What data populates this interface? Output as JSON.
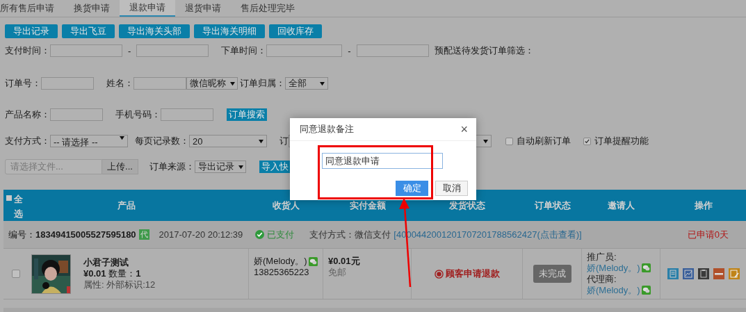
{
  "tabs": [
    {
      "label": "所有售后申请",
      "selected": false
    },
    {
      "label": "换货申请",
      "selected": false
    },
    {
      "label": "退款申请",
      "selected": true
    },
    {
      "label": "退货申请",
      "selected": false
    },
    {
      "label": "售后处理完毕",
      "selected": false
    }
  ],
  "toolbar_buttons": [
    "导出记录",
    "导出飞豆",
    "导出海关头部",
    "导出海关明细",
    "回收库存"
  ],
  "filters": {
    "pay_time_label": "支付时间：",
    "order_time_label": "下单时间：",
    "range_dash": "-",
    "presale_label": "预配送待发货订单筛选：",
    "order_no_label": "订单号：",
    "name_label": "姓名：",
    "name_type": "微信昵称",
    "ownership_label": "订单归属：",
    "ownership": "全部",
    "product_label": "产品名称：",
    "phone_label": "手机号码：",
    "search_button": "订单搜索",
    "pay_method_label": "支付方式：",
    "pay_method": "-- 请选择 --",
    "per_page_label": "每页记录数：",
    "per_page": "20",
    "cut_label": "订",
    "checkboxes": [
      {
        "label": "自动刷新订单",
        "checked": false
      },
      {
        "label": "订单提醒功能",
        "checked": true
      }
    ],
    "file_placeholder": "请选择文件...",
    "upload_button": "上传...",
    "source_label": "订单来源：",
    "source": "导出记录",
    "import_button": "导入快"
  },
  "table": {
    "select_all_label": "全选",
    "select_all_checked": false,
    "columns": [
      "产品",
      "收货人",
      "实付金额",
      "发货状态",
      "订单状态",
      "邀请人",
      "操作"
    ]
  },
  "orders": [
    {
      "number_label": "编号：",
      "number": "18349415005527595180",
      "agent_badge": "代",
      "time": "2017-07-20 20:12:39",
      "paid_status": "已支付",
      "pay_method": "支付方式：微信支付",
      "transaction": "[4000442001201707201788562427(点击查看)]",
      "applied": "已申请0天",
      "checked": false,
      "name": "小君子测试",
      "price": "¥0.01",
      "qty_label": "数量：",
      "qty": "1",
      "attrs": "属性: 外部标识:12",
      "receiver": "娇(Melody。)",
      "phone": "13825365223",
      "amount": "¥0.01元",
      "shipping": "免邮",
      "ship_status": "顾客申请退款",
      "order_status": "未完成",
      "promoter_label": "推广员:",
      "promoter": "娇(Melody。)",
      "agent_label": "代理商:",
      "agent": "娇(Melody。)"
    }
  ],
  "dialog": {
    "title": "同意退款备注",
    "close": "×",
    "value": "同意退款申请",
    "confirm": "确定",
    "cancel": "取消"
  }
}
